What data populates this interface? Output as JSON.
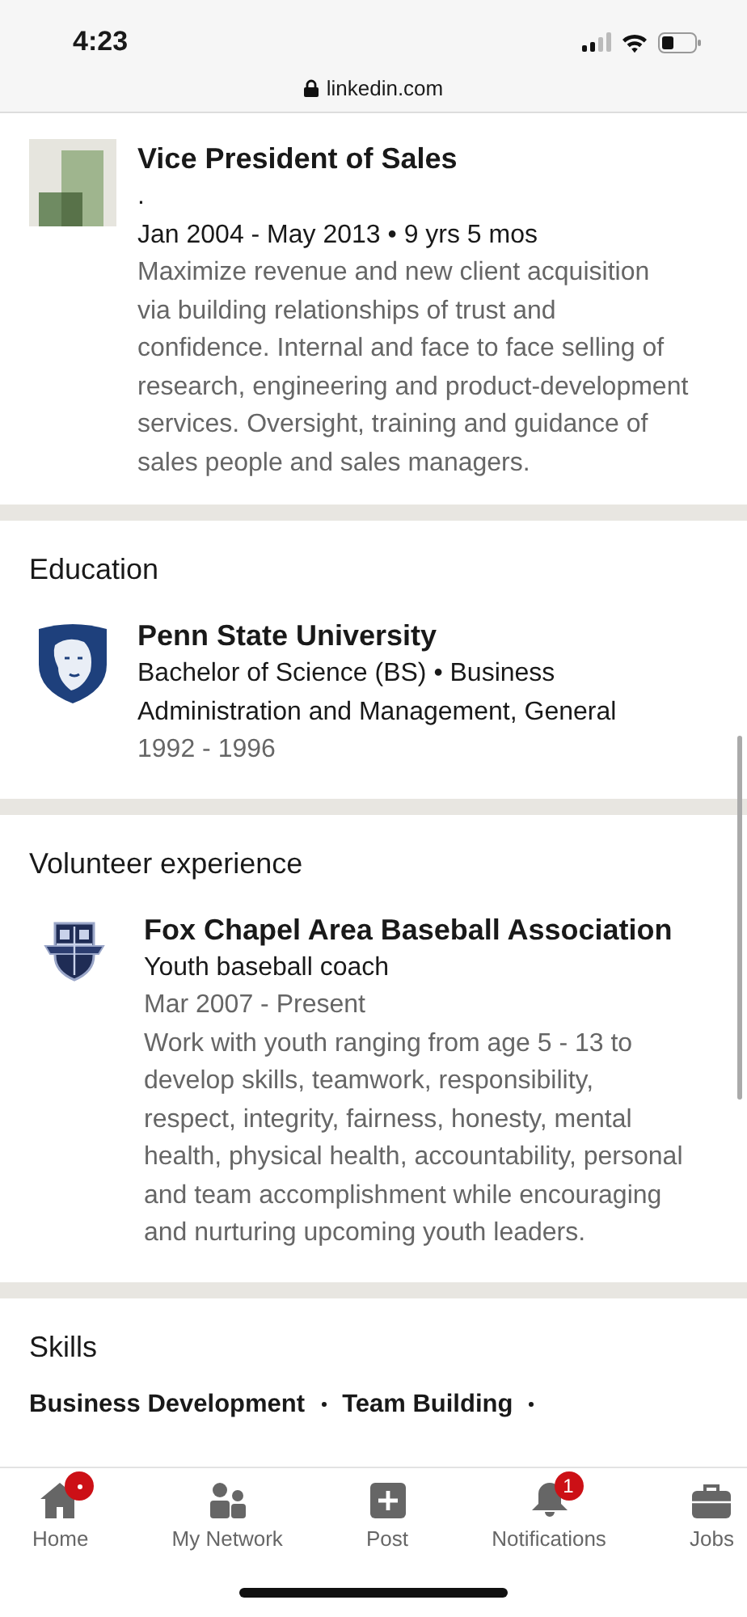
{
  "status_bar": {
    "time": "4:23"
  },
  "address_bar": {
    "url": "linkedin.com"
  },
  "experience": {
    "title": "Vice President of Sales",
    "company": ".",
    "dates": "Jan 2004 - May 2013 • 9 yrs 5 mos",
    "description": "Maximize revenue and new client acquisition via building relationships of trust and confidence. Internal and face to face selling of research, engineering and product-development services. Oversight, training and guidance of sales people and sales managers."
  },
  "education": {
    "heading": "Education",
    "school": "Penn State University",
    "degree": "Bachelor of Science (BS) • Business Administration and Management, General",
    "dates": "1992 - 1996"
  },
  "volunteer": {
    "heading": "Volunteer experience",
    "organization": "Fox Chapel Area Baseball Association",
    "role": "Youth baseball coach",
    "dates": "Mar 2007 - Present",
    "description": "Work with youth ranging from age 5 - 13 to develop skills, teamwork, responsibility, respect, integrity, fairness, honesty, mental health, physical health, accountability, personal and team accomplishment while encouraging and nurturing upcoming youth leaders."
  },
  "skills": {
    "heading": "Skills",
    "items": [
      "Business Development",
      "Team Building"
    ]
  },
  "bottom_nav": [
    {
      "kind": "home",
      "label": "Home",
      "dot": true
    },
    {
      "kind": "network",
      "label": "My Network",
      "dot": false
    },
    {
      "kind": "post",
      "label": "Post",
      "dot": false
    },
    {
      "kind": "notifications",
      "label": "Notifications",
      "dot": false,
      "badge": "1"
    },
    {
      "kind": "jobs",
      "label": "Jobs",
      "dot": false
    }
  ]
}
